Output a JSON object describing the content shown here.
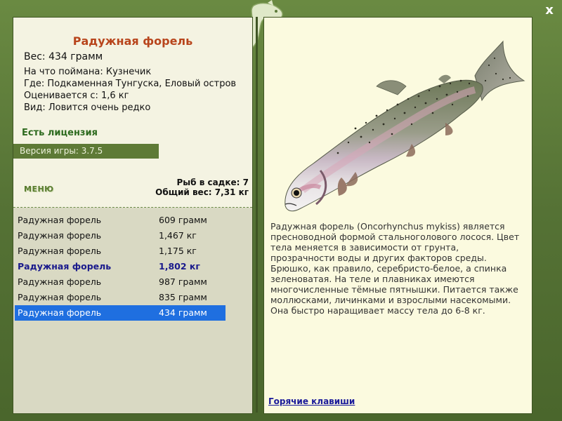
{
  "title": "Радужная форель",
  "weight": "Вес: 434 грамм",
  "caught_on": "На что поймана: Кузнечик",
  "location": "Где: Подкаменная Тунгуска, Еловый остров",
  "rated_from": "Оценивается с: 1,6 кг",
  "rarity": "Вид: Ловится очень редко",
  "license": "Есть лицензия",
  "version": "Версия игры: 3.7.5",
  "menu_label": "МЕНЮ",
  "stats": {
    "fish_count": "Рыб в садке: 7",
    "total_weight": "Общий вес: 7,31 кг"
  },
  "catch_list": [
    {
      "name": "Радужная форель",
      "weight": "609 грамм"
    },
    {
      "name": "Радужная форель",
      "weight": "1,467 кг"
    },
    {
      "name": "Радужная форель",
      "weight": "1,175 кг"
    },
    {
      "name": "Радужная форель",
      "weight": "1,802 кг"
    },
    {
      "name": "Радужная форель",
      "weight": "987 грамм"
    },
    {
      "name": "Радужная форель",
      "weight": "835 грамм"
    },
    {
      "name": "Радужная форель",
      "weight": "434 грамм"
    }
  ],
  "description": "Радужная форель (Oncorhynchus mykiss) является пресноводной формой стальноголового лосося. Цвет тела меняется в зависимости от грунта, прозрачности воды и других факторов среды. Брюшко, как правило, серебристо-белое, а спинка зеленоватая. На теле и плавниках имеются многочисленные тёмные пятнышки. Питается также моллюсками, личинками и взрослыми насекомыми. Она быстро наращивает массу тела до 6-8 кг.",
  "hotkeys": "Горячие клавиши",
  "close_glyph": "x"
}
